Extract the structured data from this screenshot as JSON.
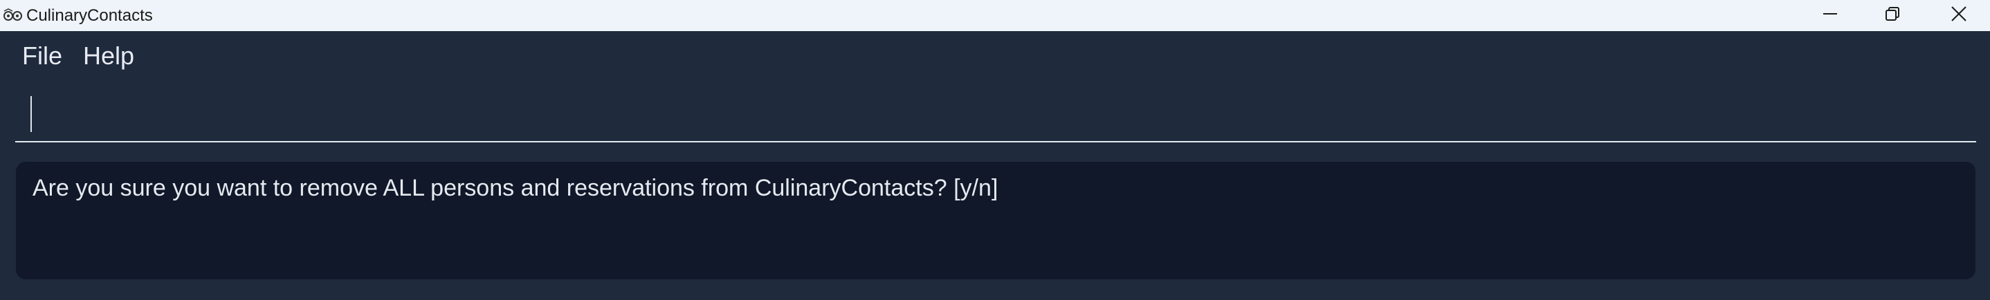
{
  "window": {
    "title": "CulinaryContacts",
    "controls": {
      "minimize_icon": "minimize-icon",
      "maximize_icon": "restore-icon",
      "close_icon": "close-icon"
    }
  },
  "menu": {
    "items": [
      {
        "label": "File"
      },
      {
        "label": "Help"
      }
    ]
  },
  "command_box": {
    "value": "",
    "placeholder": ""
  },
  "result_display": {
    "message": "Are you sure you want to remove ALL persons and reservations from CulinaryContacts? [y/n]"
  },
  "colors": {
    "background": "#1f2a3d",
    "titlebar": "#eef4f9",
    "result_background": "#101829",
    "text": "#e6eaf0"
  }
}
